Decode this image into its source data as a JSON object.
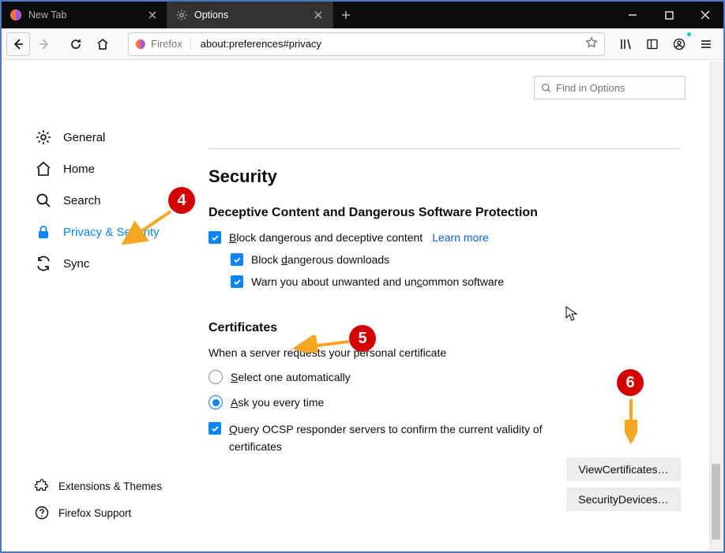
{
  "tabs": [
    {
      "label": "New Tab",
      "active": false
    },
    {
      "label": "Options",
      "active": true
    }
  ],
  "url_identity": "Firefox",
  "url": "about:preferences#privacy",
  "find_placeholder": "Find in Options",
  "sidebar": {
    "items": [
      {
        "label": "General"
      },
      {
        "label": "Home"
      },
      {
        "label": "Search"
      },
      {
        "label": "Privacy & Security"
      },
      {
        "label": "Sync"
      }
    ],
    "footer": [
      {
        "label": "Extensions & Themes"
      },
      {
        "label": "Firefox Support"
      }
    ]
  },
  "security": {
    "heading": "Security",
    "deceptive_heading": "Deceptive Content and Dangerous Software Protection",
    "block_content": "lock dangerous and deceptive content",
    "block_content_access": "B",
    "learn_more": "Learn more",
    "block_downloads": "Block ",
    "block_downloads_u": "d",
    "block_downloads_rest": "angerous downloads",
    "warn_uncommon_pre": "Warn you about unwanted and un",
    "warn_uncommon_u": "c",
    "warn_uncommon_post": "ommon software"
  },
  "certificates": {
    "heading": "Certificates",
    "desc": "When a server requests your personal certificate",
    "opt_select_pre": "",
    "opt_select_u": "S",
    "opt_select_post": "elect one automatically",
    "opt_ask_pre": "",
    "opt_ask_u": "A",
    "opt_ask_post": "sk you every time",
    "ocsp_pre": "",
    "ocsp_u": "Q",
    "ocsp_post": "uery OCSP responder servers to confirm the current validity of certificates",
    "btn_view_pre": "View ",
    "btn_view_u": "C",
    "btn_view_post": "ertificates…",
    "btn_devices_pre": "Security ",
    "btn_devices_u": "D",
    "btn_devices_post": "evices…"
  },
  "annotations": {
    "n4": "4",
    "n5": "5",
    "n6": "6"
  }
}
